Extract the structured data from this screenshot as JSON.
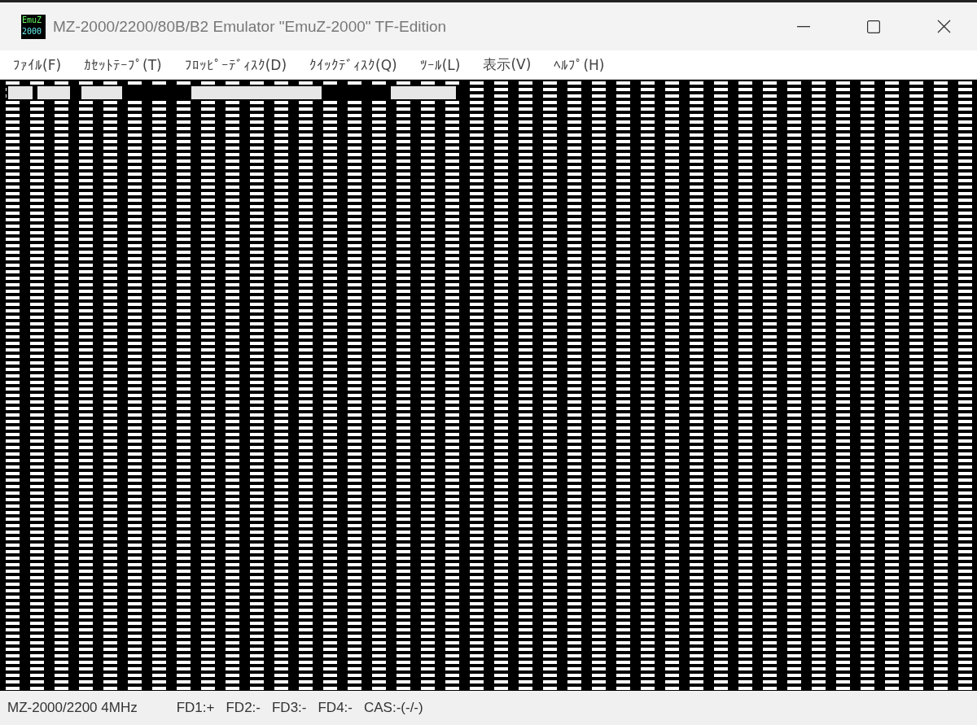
{
  "window": {
    "title": "MZ-2000/2200/80B/B2 Emulator \"EmuZ-2000\" TF-Edition",
    "logo": [
      "EmuZ",
      "2000"
    ]
  },
  "menu": [
    "ﾌｧｲﾙ(F)",
    "ｶｾｯﾄﾃｰﾌﾟ(T)",
    "ﾌﾛｯﾋﾟｰﾃﾞｨｽｸ(D)",
    "ｸｲｯｸﾃﾞｨｽｸ(Q)",
    "ﾂｰﾙ(L)",
    "表示(V)",
    "ﾍﾙﾌﾟ(H)"
  ],
  "screen": {
    "kind": "picture"
  },
  "status_bar": [
    "MZ-2000/2200 4MHz",
    "FD1:+",
    "FD2:-",
    "FD3:-",
    "FD4:-",
    "CAS:-(-/-)"
  ]
}
